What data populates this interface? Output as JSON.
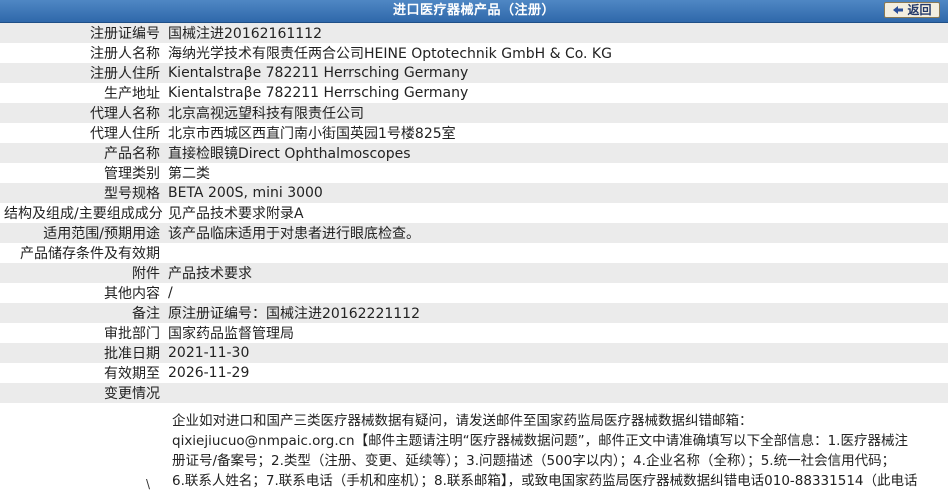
{
  "header": {
    "title": "进口医疗器械产品（注册）",
    "back_label": "返回"
  },
  "rows": [
    {
      "label": "注册证编号",
      "value": "国械注进20162161112"
    },
    {
      "label": "注册人名称",
      "value": "海纳光学技术有限责任两合公司HEINE Optotechnik GmbH & Co. KG"
    },
    {
      "label": "注册人住所",
      "value": "Kientalstraβe 782211 Herrsching Germany"
    },
    {
      "label": "生产地址",
      "value": "Kientalstraβe 782211 Herrsching Germany"
    },
    {
      "label": "代理人名称",
      "value": "北京高视远望科技有限责任公司"
    },
    {
      "label": "代理人住所",
      "value": "北京市西城区西直门南小街国英园1号楼825室"
    },
    {
      "label": "产品名称",
      "value": "直接检眼镜Direct Ophthalmoscopes"
    },
    {
      "label": "管理类别",
      "value": "第二类"
    },
    {
      "label": "型号规格",
      "value": "BETA 200S, mini 3000"
    },
    {
      "label": "结构及组成/主要组成成分",
      "value": "见产品技术要求附录A"
    },
    {
      "label": "适用范围/预期用途",
      "value": "该产品临床适用于对患者进行眼底检查。"
    },
    {
      "label": "产品储存条件及有效期",
      "value": ""
    },
    {
      "label": "附件",
      "value": "产品技术要求"
    },
    {
      "label": "其他内容",
      "value": "/"
    },
    {
      "label": "备注",
      "value": "原注册证编号：国械注进20162221112"
    },
    {
      "label": "审批部门",
      "value": "国家药品监督管理局"
    },
    {
      "label": "批准日期",
      "value": "2021-11-30"
    },
    {
      "label": "有效期至",
      "value": "2026-11-29"
    },
    {
      "label": "变更情况",
      "value": ""
    }
  ],
  "notice": {
    "line1": "企业如对进口和国产三类医疗器械数据有疑问，请发送邮件至国家药监局医疗器械数据纠错邮箱：",
    "line2": "qixiejiucuo@nmpaic.org.cn【邮件主题请注明“医疗器械数据问题”，邮件正文中请准确填写以下全部信息：1.医疗器械注",
    "line3": "册证号/备案号；2.类型（注册、变更、延续等）；3.问题描述（500字以内）；4.企业名称（全称）；5.统一社会信用代码；",
    "line4": "6.联系人姓名；7.联系电话（手机和座机）；8.联系邮箱】，或致电国家药监局医疗器械数据纠错电话010-88331514（此电话",
    "stray": "\\"
  },
  "colors": {
    "header_bg": "#3a74b6",
    "row_alt": "#ebebeb"
  }
}
